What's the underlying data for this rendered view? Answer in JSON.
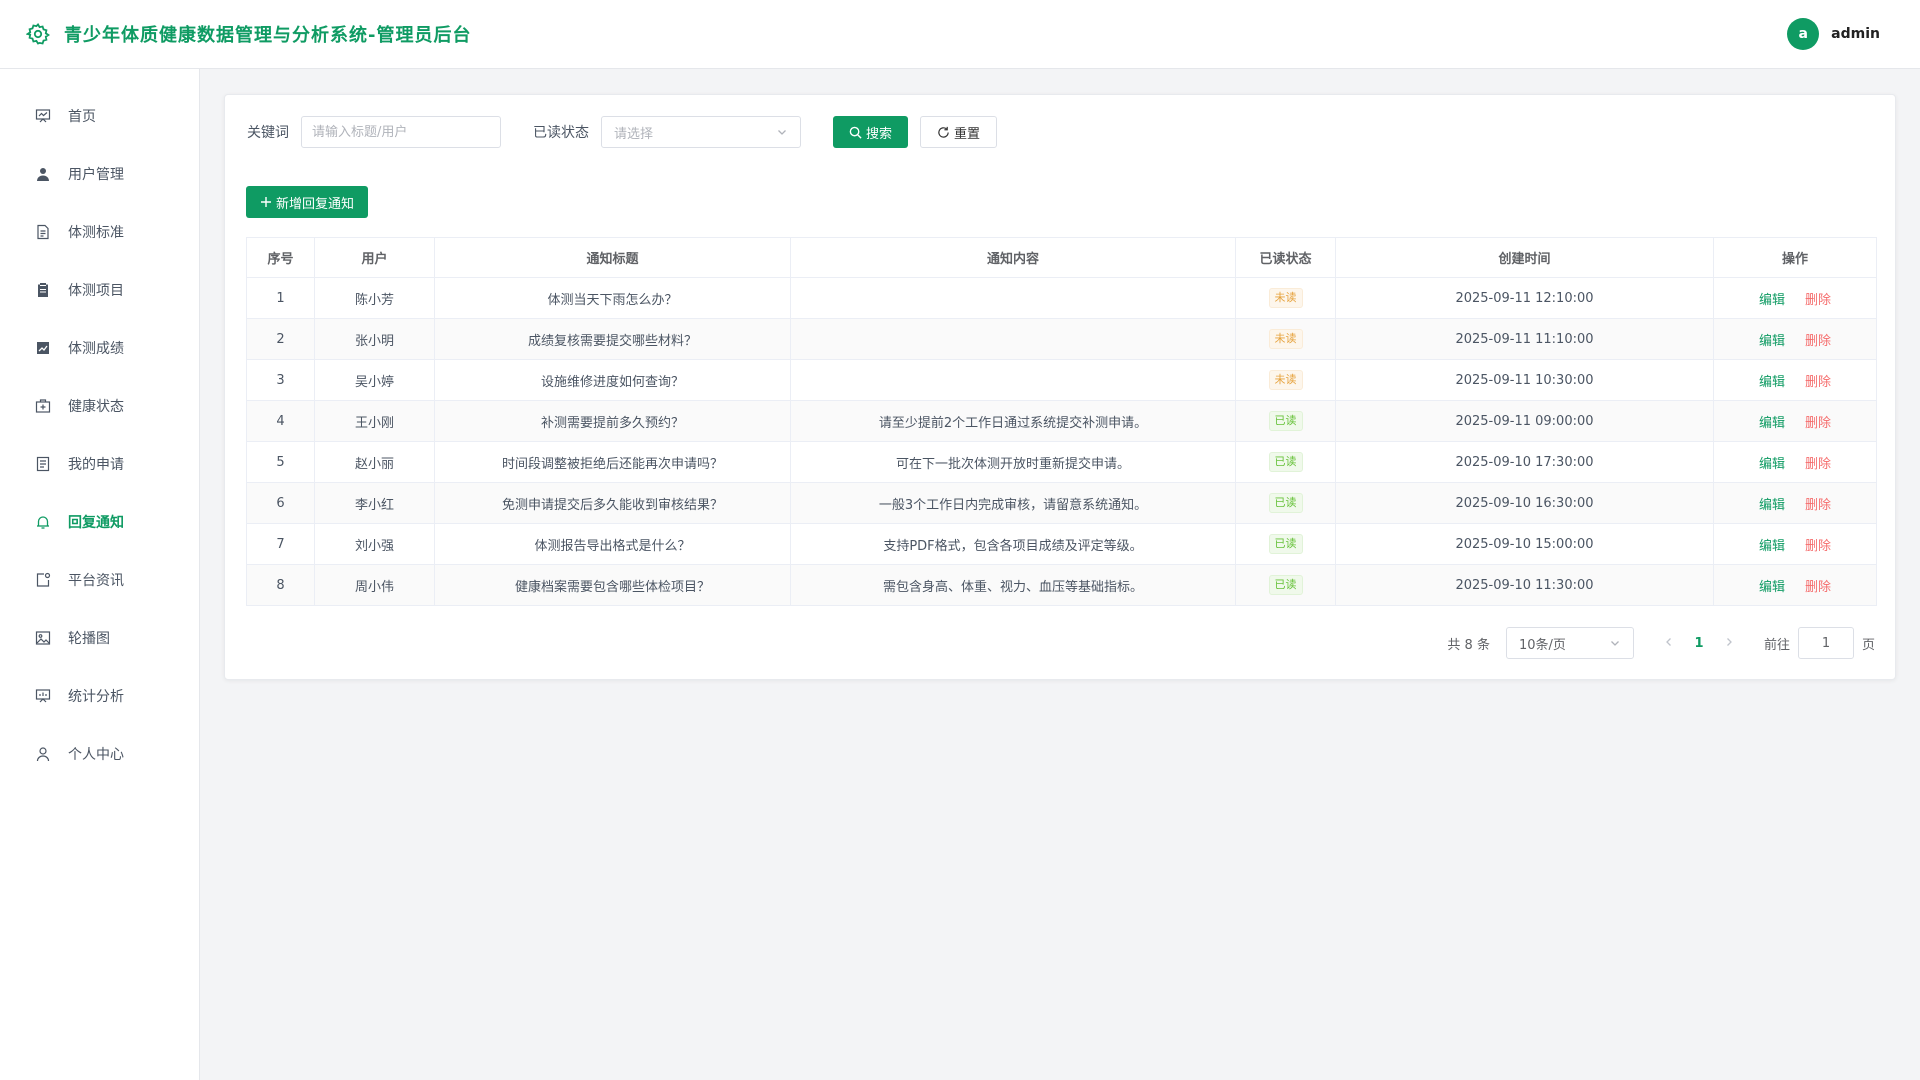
{
  "app": {
    "title": "青少年体质健康数据管理与分析系统-管理员后台"
  },
  "user": {
    "avatar_letter": "a",
    "name": "admin"
  },
  "sidebar": {
    "items": [
      {
        "label": "首页",
        "icon": "dashboard-icon"
      },
      {
        "label": "用户管理",
        "icon": "user-icon"
      },
      {
        "label": "体测标准",
        "icon": "document-icon"
      },
      {
        "label": "体测项目",
        "icon": "clipboard-icon"
      },
      {
        "label": "体测成绩",
        "icon": "chart-icon"
      },
      {
        "label": "健康状态",
        "icon": "medical-kit-icon"
      },
      {
        "label": "我的申请",
        "icon": "form-icon"
      },
      {
        "label": "回复通知",
        "icon": "bell-icon",
        "active": true
      },
      {
        "label": "平台资讯",
        "icon": "news-icon"
      },
      {
        "label": "轮播图",
        "icon": "picture-icon"
      },
      {
        "label": "统计分析",
        "icon": "presentation-icon"
      },
      {
        "label": "个人中心",
        "icon": "person-icon"
      }
    ]
  },
  "filters": {
    "keyword_label": "关键词",
    "keyword_placeholder": "请输入标题/用户",
    "status_label": "已读状态",
    "status_placeholder": "请选择",
    "search_label": "搜索",
    "reset_label": "重置"
  },
  "actions": {
    "add_label": "新增回复通知"
  },
  "table": {
    "columns": [
      "序号",
      "用户",
      "通知标题",
      "通知内容",
      "已读状态",
      "创建时间",
      "操作"
    ],
    "rows": [
      {
        "index": "1",
        "user": "陈小芳",
        "title": "体测当天下雨怎么办？",
        "content": "",
        "status": "未读",
        "created": "2025-09-11 12:10:00"
      },
      {
        "index": "2",
        "user": "张小明",
        "title": "成绩复核需要提交哪些材料？",
        "content": "",
        "status": "未读",
        "created": "2025-09-11 11:10:00"
      },
      {
        "index": "3",
        "user": "吴小婷",
        "title": "设施维修进度如何查询？",
        "content": "",
        "status": "未读",
        "created": "2025-09-11 10:30:00"
      },
      {
        "index": "4",
        "user": "王小刚",
        "title": "补测需要提前多久预约？",
        "content": "请至少提前2个工作日通过系统提交补测申请。",
        "status": "已读",
        "created": "2025-09-11 09:00:00"
      },
      {
        "index": "5",
        "user": "赵小丽",
        "title": "时间段调整被拒绝后还能再次申请吗？",
        "content": "可在下一批次体测开放时重新提交申请。",
        "status": "已读",
        "created": "2025-09-10 17:30:00"
      },
      {
        "index": "6",
        "user": "李小红",
        "title": "免测申请提交后多久能收到审核结果？",
        "content": "一般3个工作日内完成审核，请留意系统通知。",
        "status": "已读",
        "created": "2025-09-10 16:30:00"
      },
      {
        "index": "7",
        "user": "刘小强",
        "title": "体测报告导出格式是什么？",
        "content": "支持PDF格式，包含各项目成绩及评定等级。",
        "status": "已读",
        "created": "2025-09-10 15:00:00"
      },
      {
        "index": "8",
        "user": "周小伟",
        "title": "健康档案需要包含哪些体检项目？",
        "content": "需包含身高、体重、视力、血压等基础指标。",
        "status": "已读",
        "created": "2025-09-10 11:30:00"
      }
    ],
    "edit_label": "编辑",
    "delete_label": "删除"
  },
  "pagination": {
    "total_text": "共 8 条",
    "page_size": "10条/页",
    "current_page": "1",
    "goto_label": "前往",
    "goto_value": "1",
    "page_unit": "页"
  },
  "colors": {
    "primary": "#0f9b63",
    "danger": "#f56c6c",
    "unread": "#e6a23c",
    "read": "#67c23a"
  }
}
